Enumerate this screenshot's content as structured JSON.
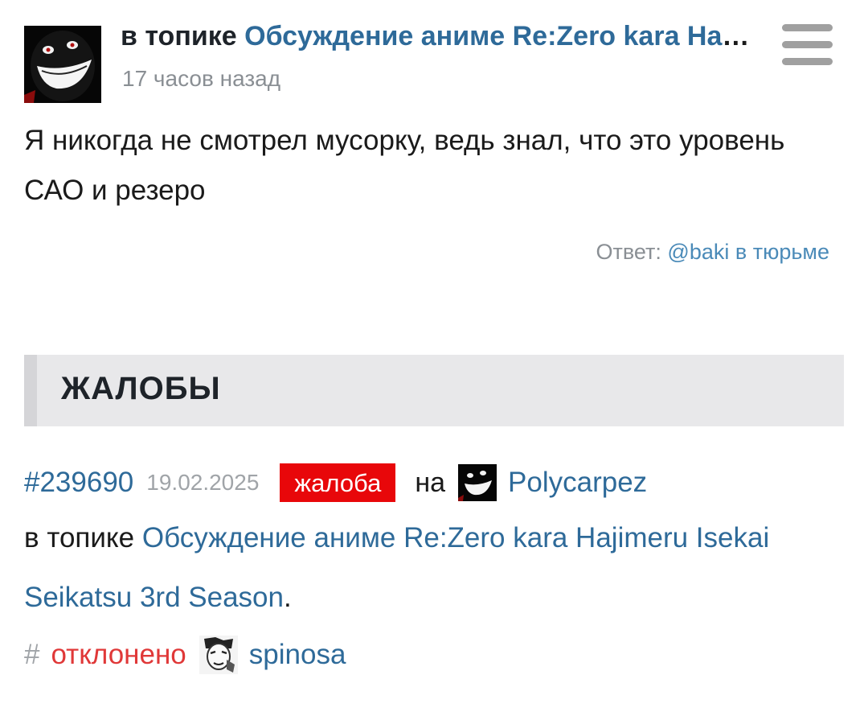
{
  "comment": {
    "topic_prefix": "в топике",
    "topic_title": "Обсуждение аниме Re:Zero kara Hajimeru Isekai Seikatsu 3rd Season",
    "time": "17 часов назад",
    "text": "Я никогда не смотрел мусорку, ведь знал, что это уровень САО и резеро",
    "reply_prefix": "Ответ:",
    "reply_to": "@baki в тюрьме",
    "avatar_icon": "grinning-dark-face-avatar",
    "menu_icon": "hamburger-menu-icon"
  },
  "complaints_section": {
    "title": "ЖАЛОБЫ"
  },
  "complaint": {
    "id": "#239690",
    "date": "19.02.2025",
    "badge": "жалоба",
    "on_label": "на",
    "target_user": "Polycarpez",
    "topic_prefix": "в топике",
    "topic_title": "Обсуждение аниме Re:Zero kara Hajimeru Isekai Seikatsu 3rd Season",
    "topic_end": ".",
    "status_hash": "#",
    "status": "отклонено",
    "moderator": "spinosa"
  },
  "colors": {
    "link": "#2e6a99",
    "badge_bg": "#e8070a",
    "status_rejected": "#e03838",
    "muted": "#8a8f94"
  }
}
